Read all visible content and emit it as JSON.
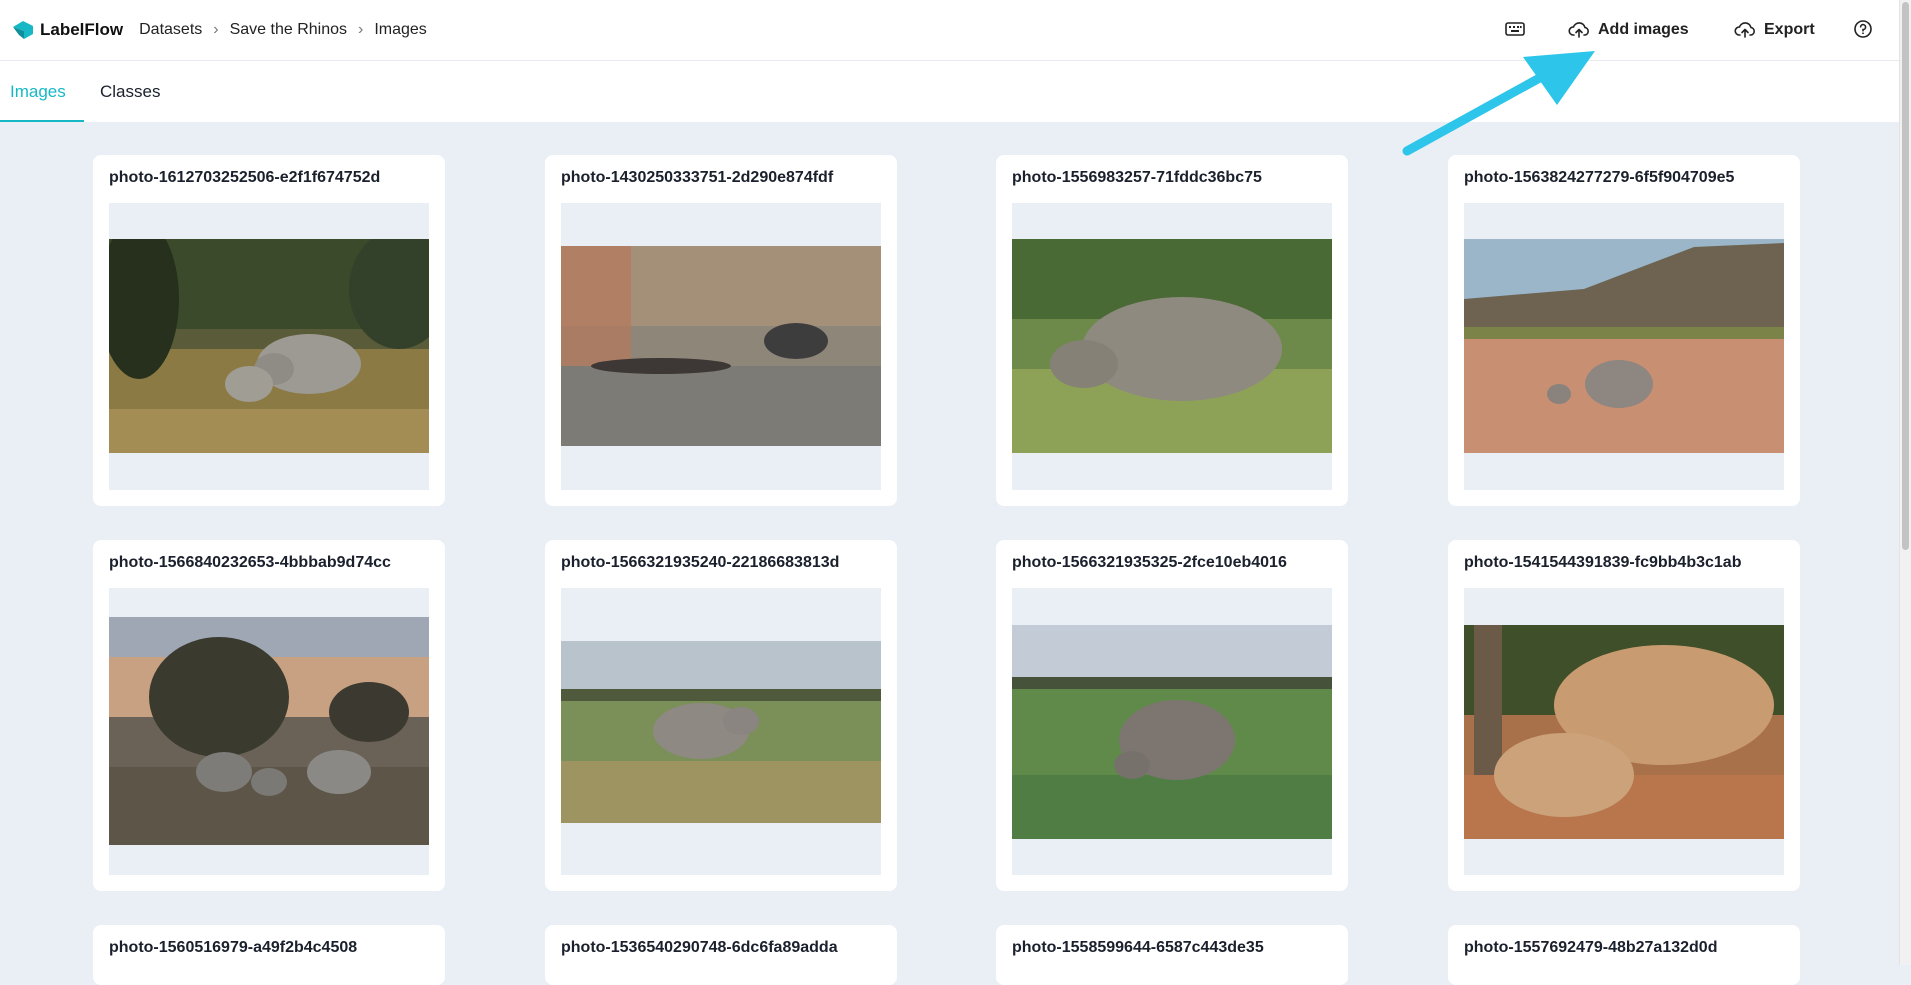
{
  "app": {
    "name": "LabelFlow"
  },
  "breadcrumb": [
    {
      "label": "Datasets"
    },
    {
      "label": "Save the Rhinos"
    },
    {
      "label": "Images"
    }
  ],
  "breadcrumb_separator": "›",
  "toolbar": {
    "keyboard_icon": "keyboard-icon",
    "add_images_label": "Add images",
    "export_label": "Export",
    "help_icon": "help-circle-icon"
  },
  "tabs": [
    {
      "label": "Images",
      "active": true
    },
    {
      "label": "Classes",
      "active": false
    }
  ],
  "colors": {
    "accent": "#17b8c6",
    "arrow": "#2dc6ea",
    "page_background": "#e9eff5"
  },
  "images": [
    {
      "name": "photo-1612703252506-e2f1f674752d"
    },
    {
      "name": "photo-1430250333751-2d290e874fdf"
    },
    {
      "name": "photo-1556983257-71fddc36bc75"
    },
    {
      "name": "photo-1563824277279-6f5f904709e5"
    },
    {
      "name": "photo-1566840232653-4bbbab9d74cc"
    },
    {
      "name": "photo-1566321935240-22186683813d"
    },
    {
      "name": "photo-1566321935325-2fce10eb4016"
    },
    {
      "name": "photo-1541544391839-fc9bb4b3c1ab"
    },
    {
      "name": "photo-1560516979-a49f2b4c4508"
    },
    {
      "name": "photo-1536540290748-6dc6fa89adda"
    },
    {
      "name": "photo-1558599644-6587c443de35"
    },
    {
      "name": "photo-1557692479-48b27a132d0d"
    }
  ]
}
